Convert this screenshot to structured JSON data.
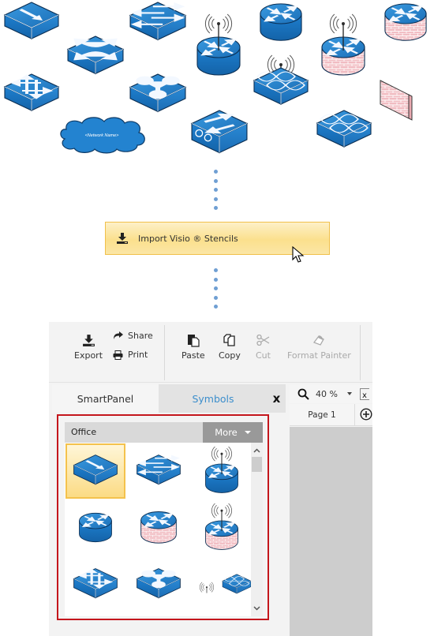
{
  "stencil_preview": {
    "cloud_label": "<Network Name>",
    "shapes": [
      "switch-one-way",
      "multilayer-switch",
      "wireless-router",
      "router",
      "firewall-router",
      "atm-switch",
      "wireless-firewall-router",
      "layer3-switch",
      "network-hub",
      "wireless-bridge",
      "firewall",
      "network-cloud",
      "sdh-adm",
      "bridge"
    ]
  },
  "connector": {
    "dots_above": 5,
    "dots_below": 5,
    "color": "#6f9fd3"
  },
  "import_button": {
    "label": "Import Visio ® Stencils",
    "icon": "import-icon"
  },
  "ribbon": {
    "export": "Export",
    "share": "Share",
    "print": "Print",
    "paste": "Paste",
    "copy": "Copy",
    "cut": "Cut",
    "format_painter": "Format Painter"
  },
  "panel": {
    "tabs": [
      {
        "label": "SmartPanel",
        "active": false
      },
      {
        "label": "Symbols",
        "active": true
      }
    ],
    "close": "x",
    "library": {
      "title": "Office",
      "more_label": "More",
      "symbols": [
        {
          "name": "Switch",
          "selected": true
        },
        {
          "name": "Multilayer Switch",
          "selected": false
        },
        {
          "name": "Wireless Router",
          "selected": false
        },
        {
          "name": "Router",
          "selected": false
        },
        {
          "name": "Firewall Router",
          "selected": false
        },
        {
          "name": "Wireless Firewall Router",
          "selected": false
        },
        {
          "name": "ATM Switch",
          "selected": false
        },
        {
          "name": "Layer 3 Switch",
          "selected": false
        },
        {
          "name": "Wireless Bridge",
          "selected": false
        }
      ]
    }
  },
  "canvas": {
    "zoom": "40 %",
    "page_tab": "Page 1"
  },
  "colors": {
    "accent_blue": "#3c8ecc",
    "highlight_border": "#c4161c",
    "import_gold": "#fbe08d",
    "device_blue": "#1f7fc9"
  }
}
